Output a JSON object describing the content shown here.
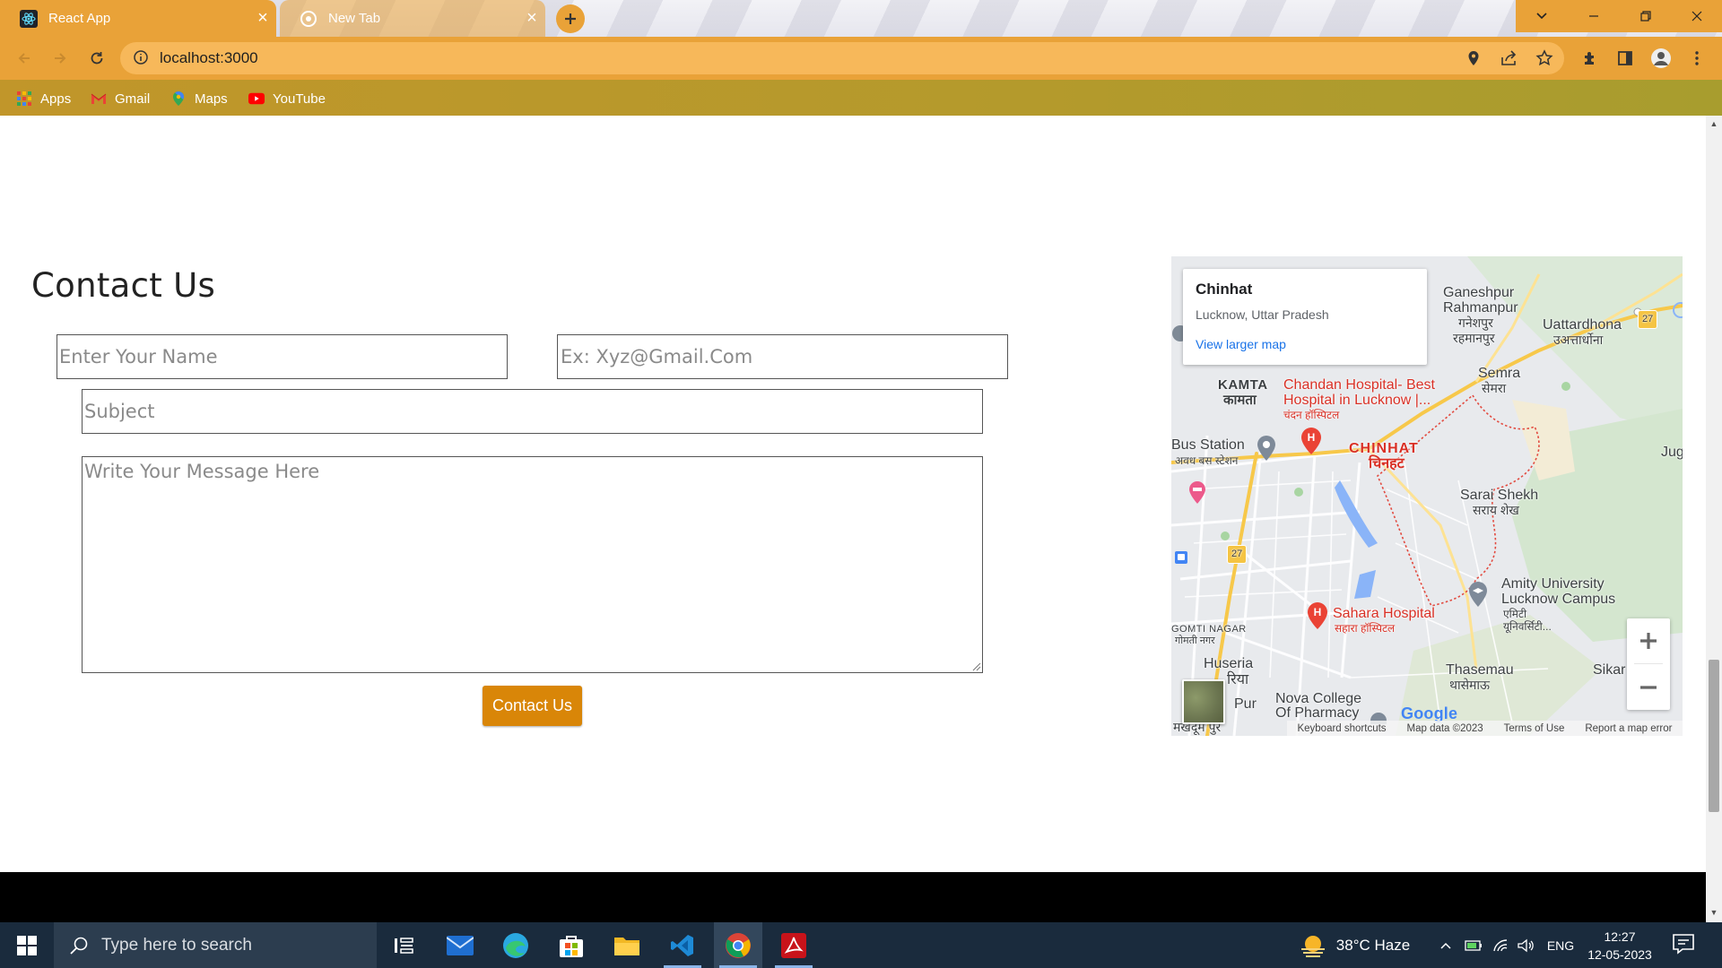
{
  "browser": {
    "tabs": [
      {
        "title": "React App",
        "active": true,
        "favicon": "react-icon"
      },
      {
        "title": "New Tab",
        "active": false,
        "favicon": "chrome-icon"
      }
    ],
    "address_bar": {
      "url": "localhost:3000"
    },
    "bookmarks": [
      {
        "label": "Apps",
        "icon": "apps-grid-icon"
      },
      {
        "label": "Gmail",
        "icon": "gmail-icon"
      },
      {
        "label": "Maps",
        "icon": "maps-icon"
      },
      {
        "label": "YouTube",
        "icon": "youtube-icon"
      }
    ],
    "accent_color": "#e9a238"
  },
  "contact": {
    "title": "Contact Us",
    "name_placeholder": "Enter Your Name",
    "email_placeholder": "Ex: Xyz@Gmail.Com",
    "subject_placeholder": "Subject",
    "message_placeholder": "Write Your Message Here",
    "submit_label": "Contact Us",
    "button_color": "#d98608"
  },
  "map": {
    "card": {
      "title": "Chinhat",
      "subtitle": "Lucknow, Uttar Pradesh",
      "link": "View larger map"
    },
    "labels": {
      "ganeshpur": "Ganeshpur",
      "rahmanpur": "Rahmanpur",
      "ganeshpur_hi": "गनेशपुर",
      "rahmanpur_hi": "रहमानपुर",
      "uattardhona": "Uattardhona",
      "uattardhona_hi": "उअत्तार्धोना",
      "semra": "Semra",
      "semra_hi": "सेमरा",
      "kamta": "KAMTA",
      "kamta_hi": "कामता",
      "chandan1": "Chandan Hospital- Best",
      "chandan2": "Hospital in Lucknow |...",
      "chandan_hi": "चंदन हॉस्पिटल",
      "bus_station": "Bus Station",
      "bus_station_hi": "अवध बस स्टेशन",
      "chinhat": "CHINHAT",
      "chinhat_hi": "चिनहट",
      "sarai1": "Sarai Shekh",
      "sarai_hi": "सराय शेख",
      "amity1": "Amity University",
      "amity2": "Lucknow Campus",
      "amity_hi1": "एमिटी",
      "amity_hi2": "यूनिवर्सिटी...",
      "sahara": "Sahara Hospital",
      "sahara_hi": "सहारा हॉस्पिटल",
      "gomti": "GOMTI NAGAR",
      "gomti_hi": "गोमती नगर",
      "huseria": "Huseria",
      "huseria_hi": "रिया",
      "thasemau": "Thasemau",
      "thasemau_hi": "थासेमाऊ",
      "nova1": "Nova College",
      "nova2": "Of Pharmacy",
      "pur": "Pur",
      "makhdum_hi": "मखदूम पुर",
      "sikar": "Sikar",
      "juggaur": "Jug",
      "road27a": "27",
      "road27b": "27"
    },
    "google": "Google",
    "footer": [
      "Keyboard shortcuts",
      "Map data ©2023",
      "Terms of Use",
      "Report a map error"
    ]
  },
  "taskbar": {
    "search_placeholder": "Type here to search",
    "weather": "38°C  Haze",
    "language": "ENG",
    "time": "12:27",
    "date": "12-05-2023",
    "apps": [
      "task-view-icon",
      "mail-icon",
      "edge-icon",
      "store-icon",
      "file-explorer-icon",
      "vscode-icon",
      "chrome-icon",
      "acrobat-icon"
    ]
  }
}
